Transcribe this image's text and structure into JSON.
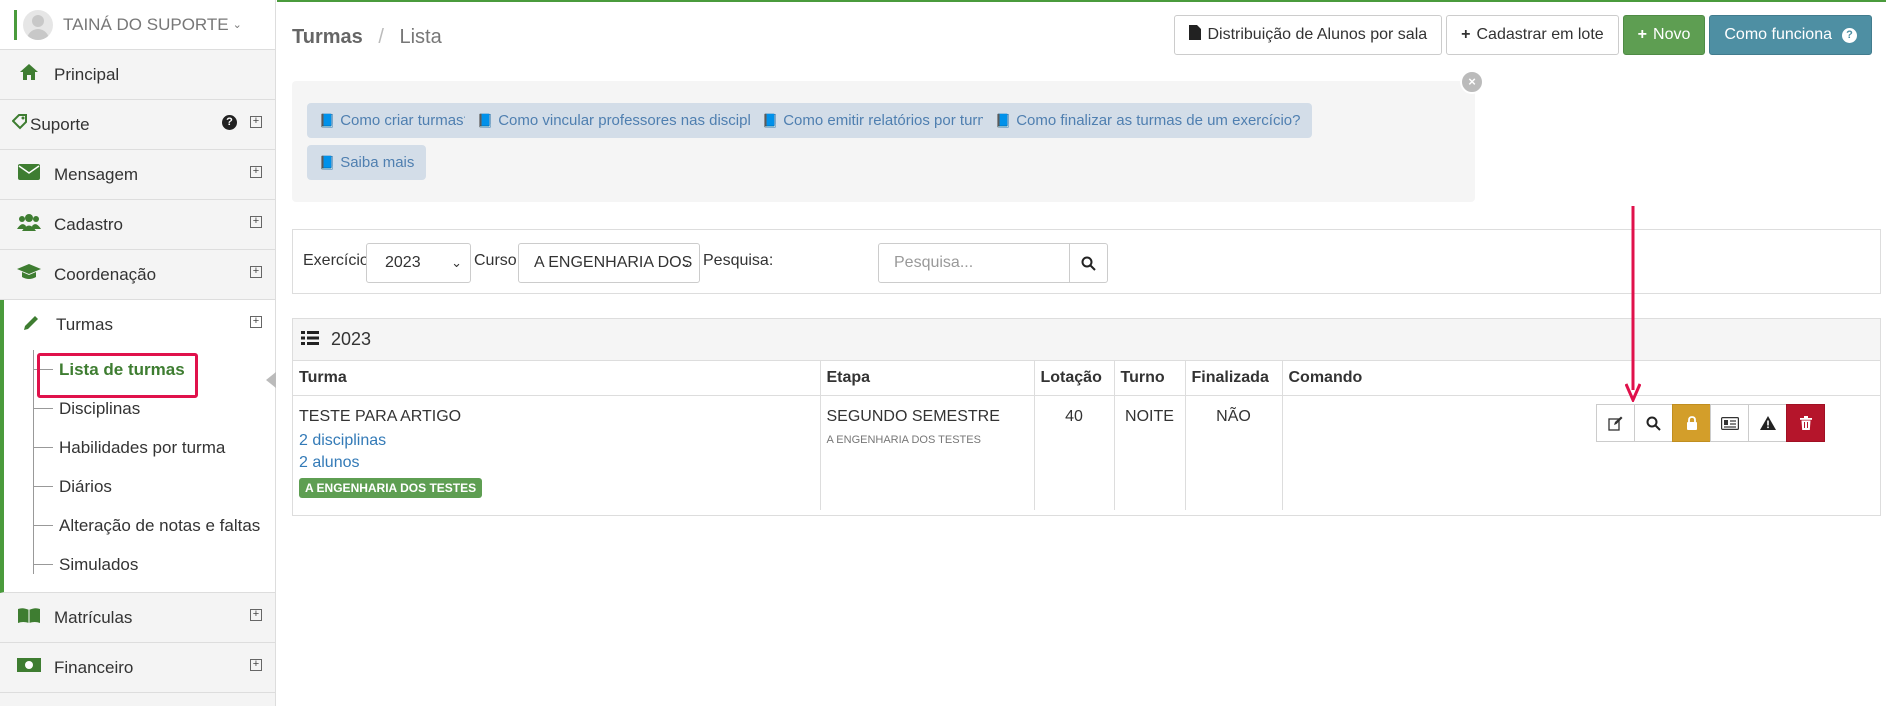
{
  "user": {
    "name": "TAINÁ DO SUPORTE"
  },
  "sidebar": {
    "items": [
      {
        "label": "Principal",
        "icon": "home-icon"
      },
      {
        "label": "Suporte",
        "icon": "tag-icon"
      },
      {
        "label": "Mensagem",
        "icon": "envelope-icon"
      },
      {
        "label": "Cadastro",
        "icon": "users-icon"
      },
      {
        "label": "Coordenação",
        "icon": "graduation-cap-icon"
      },
      {
        "label": "Turmas",
        "icon": "pencil-icon"
      },
      {
        "label": "Matrículas",
        "icon": "book-icon"
      },
      {
        "label": "Financeiro",
        "icon": "money-icon"
      }
    ],
    "turmas_sub": [
      "Lista de turmas",
      "Disciplinas",
      "Habilidades por turma",
      "Diários",
      "Alteração de notas e faltas",
      "Simulados"
    ],
    "help_badge": "?",
    "expand_symbol": "+"
  },
  "breadcrumb": {
    "section": "Turmas",
    "separator": "/",
    "page": "Lista"
  },
  "toolbar": {
    "distribuicao": "Distribuição de Alunos por sala",
    "lote": "Cadastrar em lote",
    "novo": "Novo",
    "como_funciona": "Como funciona",
    "help_q": "?"
  },
  "help_links": [
    "Como criar turmas?",
    "Como vincular professores nas disciplinas?",
    "Como emitir relatórios por turma?",
    "Como finalizar as turmas de um exercício?",
    "Saiba mais"
  ],
  "close_symbol": "×",
  "filter": {
    "exercicio_label": "Exercício:",
    "exercicio_value": "2023",
    "curso_label": "Curso:",
    "curso_value": "A ENGENHARIA DOS",
    "pesquisa_label": "Pesquisa:",
    "pesquisa_placeholder": "Pesquisa..."
  },
  "panel": {
    "title": "2023"
  },
  "table": {
    "headers": [
      "Turma",
      "Etapa",
      "Lotação",
      "Turno",
      "Finalizada",
      "Comando"
    ],
    "row": {
      "turma": "TESTE PARA ARTIGO",
      "disciplinas": "2 disciplinas",
      "alunos": "2 alunos",
      "tag": "A ENGENHARIA DOS TESTES",
      "etapa": "SEGUNDO SEMESTRE",
      "etapa_curso": "A ENGENHARIA DOS TESTES",
      "lotacao": "40",
      "turno": "NOITE",
      "finalizada": "NÃO"
    }
  },
  "colors": {
    "accent": "#4a9b3c",
    "annotation": "#e0114b"
  }
}
